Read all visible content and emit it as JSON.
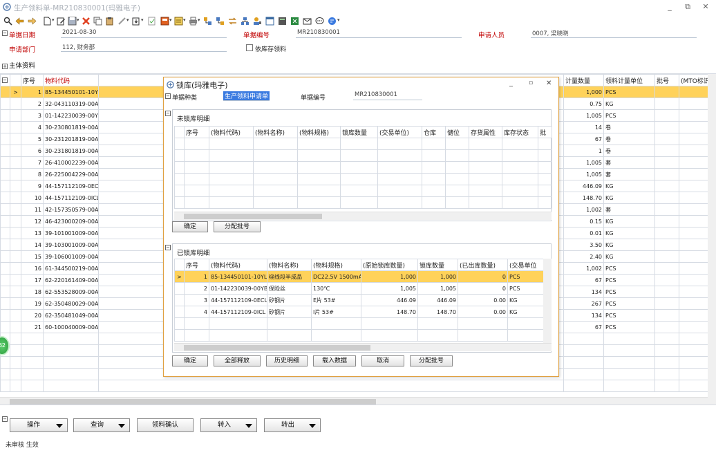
{
  "window": {
    "title": "生产领料单-MR210830001(玛雅电子)",
    "min": "_",
    "restore": "⧉",
    "close": "✕"
  },
  "header": {
    "date_label": "单据日期",
    "date_value": "2021-08-30",
    "billno_label": "单据编号",
    "billno_value": "MR210830001",
    "applicant_label": "申请人员",
    "applicant_value": "0007, 梁晓晓",
    "dept_label": "申请部门",
    "dept_value": "112, 财务部",
    "stock_checkbox_label": "依库存领料"
  },
  "main_section": "主体资料",
  "main_grid": {
    "columns": [
      "序号",
      "物料代码"
    ],
    "right_columns": [
      "计量数量",
      "领料计量单位",
      "批号",
      "(MTO标识号"
    ],
    "rows": [
      {
        "no": "1",
        "code": "85-134450101-10YL",
        "qty": "1,000",
        "unit": "PCS"
      },
      {
        "no": "2",
        "code": "32-043110319-00A1",
        "qty": "0.75",
        "unit": "KG"
      },
      {
        "no": "3",
        "code": "01-142230039-00YB",
        "qty": "1,005",
        "unit": "PCS"
      },
      {
        "no": "4",
        "code": "30-230801819-00A1",
        "qty": "14",
        "unit": "卷"
      },
      {
        "no": "5",
        "code": "30-231201819-00A1",
        "qty": "67",
        "unit": "卷"
      },
      {
        "no": "6",
        "code": "30-231801819-00A1",
        "qty": "1",
        "unit": "卷"
      },
      {
        "no": "7",
        "code": "26-410002239-00A1",
        "qty": "1,005",
        "unit": "套"
      },
      {
        "no": "8",
        "code": "26-225004229-00A1",
        "qty": "1,005",
        "unit": "套"
      },
      {
        "no": "9",
        "code": "44-157112109-0ECL",
        "qty": "446.09",
        "unit": "KG"
      },
      {
        "no": "10",
        "code": "44-157112109-0ICL",
        "qty": "148.70",
        "unit": "KG"
      },
      {
        "no": "11",
        "code": "42-157350579-00A1",
        "qty": "1,002",
        "unit": "套"
      },
      {
        "no": "12",
        "code": "46-423000209-00A1",
        "qty": "0.15",
        "unit": "KG"
      },
      {
        "no": "13",
        "code": "39-101001009-00A1",
        "qty": "0.01",
        "unit": "KG"
      },
      {
        "no": "14",
        "code": "39-103001009-00A1",
        "qty": "3.50",
        "unit": "KG"
      },
      {
        "no": "15",
        "code": "39-106001009-00A1",
        "qty": "2.40",
        "unit": "KG"
      },
      {
        "no": "16",
        "code": "61-344500219-00A1",
        "qty": "1,002",
        "unit": "PCS"
      },
      {
        "no": "17",
        "code": "62-220161409-00A1",
        "qty": "67",
        "unit": "PCS"
      },
      {
        "no": "18",
        "code": "62-553528009-00A1",
        "qty": "134",
        "unit": "PCS"
      },
      {
        "no": "19",
        "code": "62-350480029-00A1",
        "qty": "267",
        "unit": "PCS"
      },
      {
        "no": "20",
        "code": "62-350481049-00A1",
        "qty": "134",
        "unit": "PCS"
      },
      {
        "no": "21",
        "code": "60-100040009-00A1",
        "qty": "67",
        "unit": "PCS"
      }
    ]
  },
  "badge": "62",
  "footer": {
    "operate": "操作",
    "query": "查询",
    "confirm": "领料确认",
    "transfer": "转入",
    "export": "转出",
    "status": "未审核 生效"
  },
  "dialog": {
    "title": "锁库(玛雅电子)",
    "type_label": "单据种类",
    "type_value": "生产领料申请单",
    "billno_label": "单据编号",
    "billno_value": "MR210830001",
    "unlocked_title": "未锁库明细",
    "unlocked_columns": [
      "序号",
      "(物料代码)",
      "(物料名称)",
      "(物料规格)",
      "锁库数量",
      "(交易单位)",
      "仓库",
      "储位",
      "存货属性",
      "库存状态",
      "批"
    ],
    "unlocked_buttons": {
      "ok": "确定",
      "alloc": "分配批号"
    },
    "locked_title": "已锁库明细",
    "locked_columns": [
      "序号",
      "(物料代码)",
      "(物料名称)",
      "(物料规格)",
      "(原始锁库数量)",
      "锁库数量",
      "(已出库数量)",
      "(交易单位"
    ],
    "locked_rows": [
      {
        "no": "1",
        "code": "85-134450101-10YL",
        "name": "绕线段半成品",
        "spec": "DC22.5V 1500mA",
        "orig": "1,000",
        "lock": "1,000",
        "out": "0",
        "unit": "PCS"
      },
      {
        "no": "2",
        "code": "01-142230039-00YB",
        "name": "保险丝",
        "spec": "130℃",
        "orig": "1,005",
        "lock": "1,005",
        "out": "0",
        "unit": "PCS"
      },
      {
        "no": "3",
        "code": "44-157112109-0ECL",
        "name": "矽钢片",
        "spec": "E片 53#",
        "orig": "446.09",
        "lock": "446.09",
        "out": "0.00",
        "unit": "KG"
      },
      {
        "no": "4",
        "code": "44-157112109-0ICL",
        "name": "矽钢片",
        "spec": "I片 53#",
        "orig": "148.70",
        "lock": "148.70",
        "out": "0.00",
        "unit": "KG"
      }
    ],
    "buttons": {
      "ok": "确定",
      "release": "全部释放",
      "history": "历史明细",
      "load": "载入数据",
      "cancel": "取消",
      "alloc": "分配批号"
    }
  }
}
